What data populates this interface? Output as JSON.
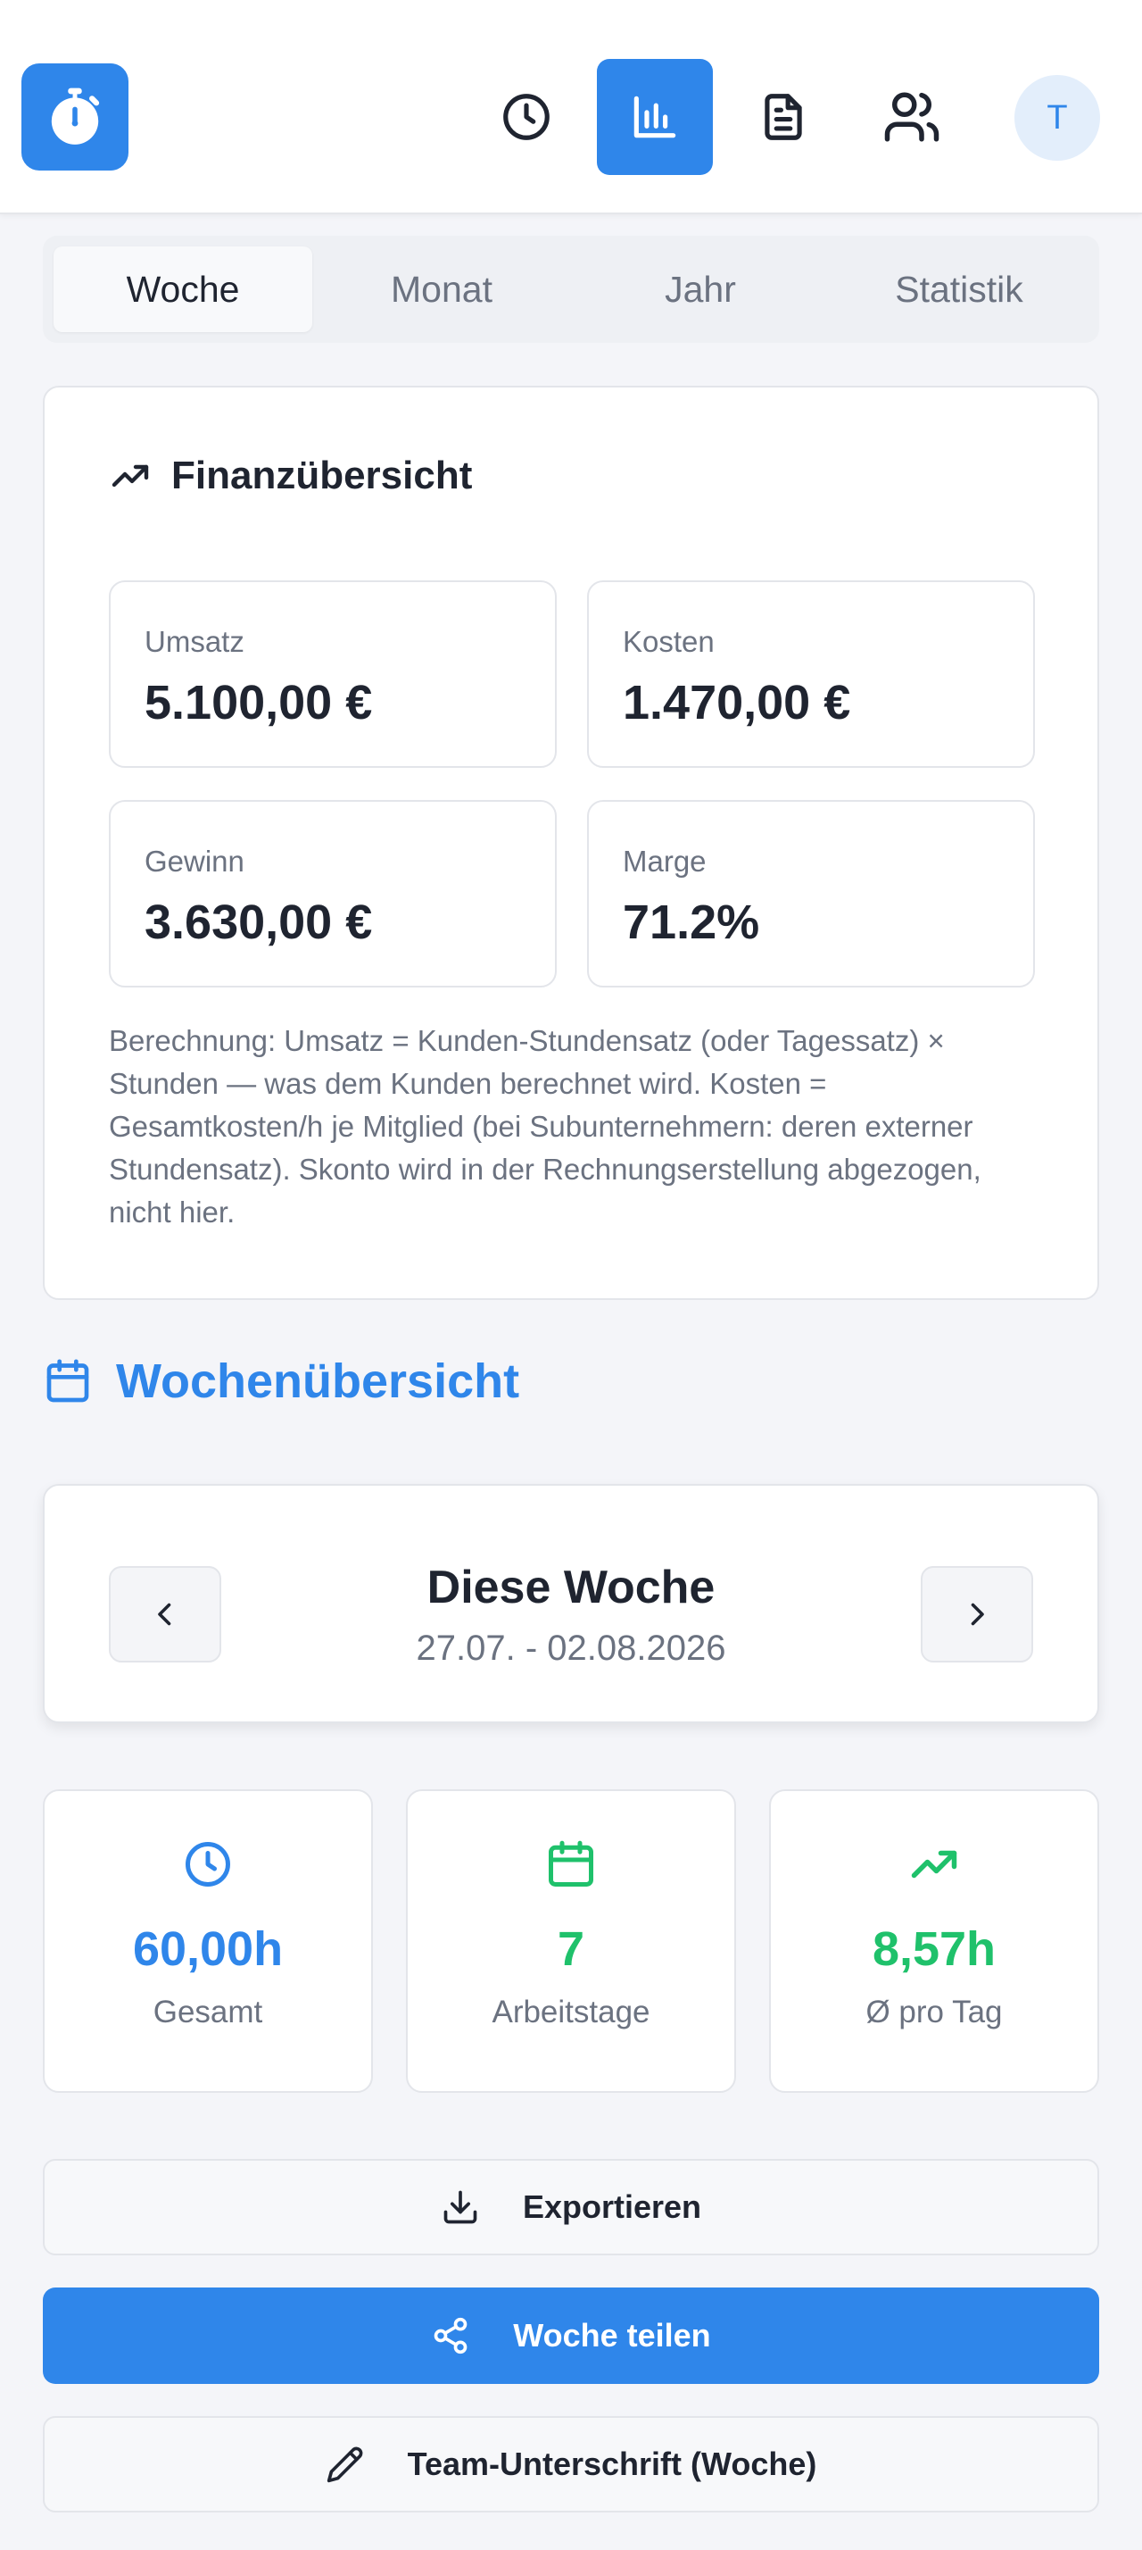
{
  "header": {
    "logo_icon": "stopwatch-icon",
    "nav": [
      {
        "icon": "clock-icon",
        "active": false
      },
      {
        "icon": "bar-chart-icon",
        "active": true
      },
      {
        "icon": "document-icon",
        "active": false
      },
      {
        "icon": "users-icon",
        "active": false
      }
    ],
    "avatar_initial": "T"
  },
  "tabs": [
    {
      "label": "Woche",
      "active": true
    },
    {
      "label": "Monat",
      "active": false
    },
    {
      "label": "Jahr",
      "active": false
    },
    {
      "label": "Statistik",
      "active": false
    }
  ],
  "finance": {
    "title": "Finanzübersicht",
    "umsatz_label": "Umsatz",
    "umsatz_value": "5.100,00 €",
    "kosten_label": "Kosten",
    "kosten_value": "1.470,00 €",
    "gewinn_label": "Gewinn",
    "gewinn_value": "3.630,00 €",
    "marge_label": "Marge",
    "marge_value": "71.2%",
    "note": "Berechnung: Umsatz = Kunden-Stundensatz (oder Tagessatz) × Stunden — was dem Kunden berechnet wird. Kosten = Gesamtkosten/h je Mitglied (bei Subunternehmern: deren externer Stundensatz). Skonto wird in der Rechnungserstellung abgezogen, nicht hier."
  },
  "week_overview": {
    "title": "Wochenübersicht",
    "current_label": "Diese Woche",
    "range": "27.07. - 02.08.2026"
  },
  "stats": {
    "total_value": "60,00h",
    "total_label": "Gesamt",
    "days_value": "7",
    "days_label": "Arbeitstage",
    "avg_value": "8,57h",
    "avg_label": "Ø pro Tag"
  },
  "actions": {
    "export_label": "Exportieren",
    "share_label": "Woche teilen",
    "signature_label": "Team-Unterschrift (Woche)"
  },
  "colors": {
    "accent": "#2f86ea",
    "success": "#1fc16b",
    "text": "#1f2430",
    "muted": "#6b7280"
  }
}
